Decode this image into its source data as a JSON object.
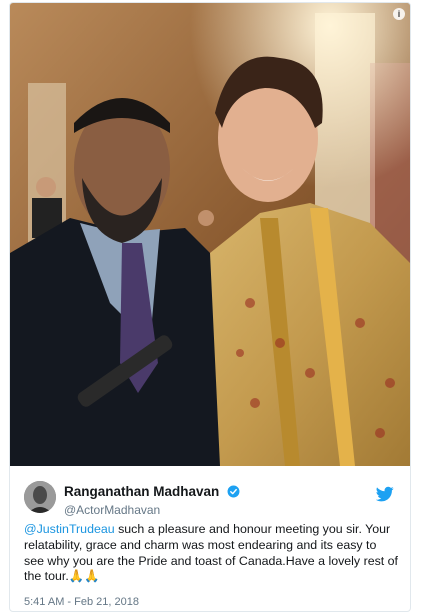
{
  "tweet": {
    "info_icon": "info-icon",
    "author": {
      "display_name": "Ranganathan Madhavan",
      "handle": "@ActorMadhavan",
      "verified": true,
      "avatar_icon": "avatar"
    },
    "platform_icon": "twitter-bird-icon",
    "text": {
      "mention": "@JustinTrudeau",
      "body": " such a pleasure and honour meeting you sir. Your relatability, grace and charm was most endearing and its easy to see why you are the Pride and toast of Canada.Have a lovely rest of the tour.",
      "emoji": "🙏🙏"
    },
    "timestamp": "5:41 AM - Feb 21, 2018"
  },
  "colors": {
    "link": "#1b95e0",
    "verified": "#1da1f2",
    "secondary_text": "#657786",
    "border": "#e1e8ed"
  }
}
